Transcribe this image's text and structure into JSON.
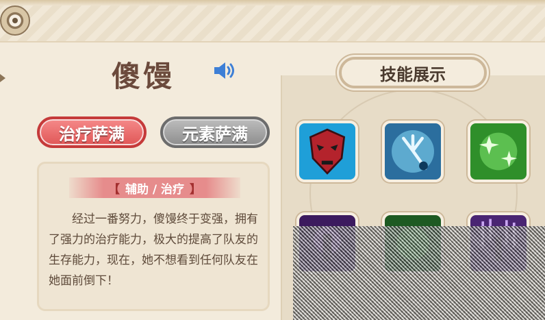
{
  "hero": {
    "name": "傻馒"
  },
  "classes": [
    {
      "label": "治疗萨满",
      "active": true
    },
    {
      "label": "元素萨满",
      "active": false
    }
  ],
  "description": {
    "role_prefix": "【",
    "role_text": "辅助 / 治疗",
    "role_suffix": "】",
    "text": "经过一番努力，傻馒终于变强，拥有了强力的治疗能力，极大的提高了队友的生存能力，现在，她不想看到任何队友在她面前倒下！"
  },
  "skills": {
    "title": "技能展示",
    "items": [
      {
        "icon": "tribal-mask-icon"
      },
      {
        "icon": "ice-trident-icon"
      },
      {
        "icon": "green-sparkle-icon"
      },
      {
        "icon": "purple-totem-icon"
      },
      {
        "icon": "green-spirit-icon"
      },
      {
        "icon": "purple-rain-icon"
      }
    ]
  },
  "colors": {
    "active_class": "#e05656",
    "inactive_class": "#8d8d8d",
    "name_text": "#6b4a3c",
    "voice_icon": "#3d7fd6"
  }
}
